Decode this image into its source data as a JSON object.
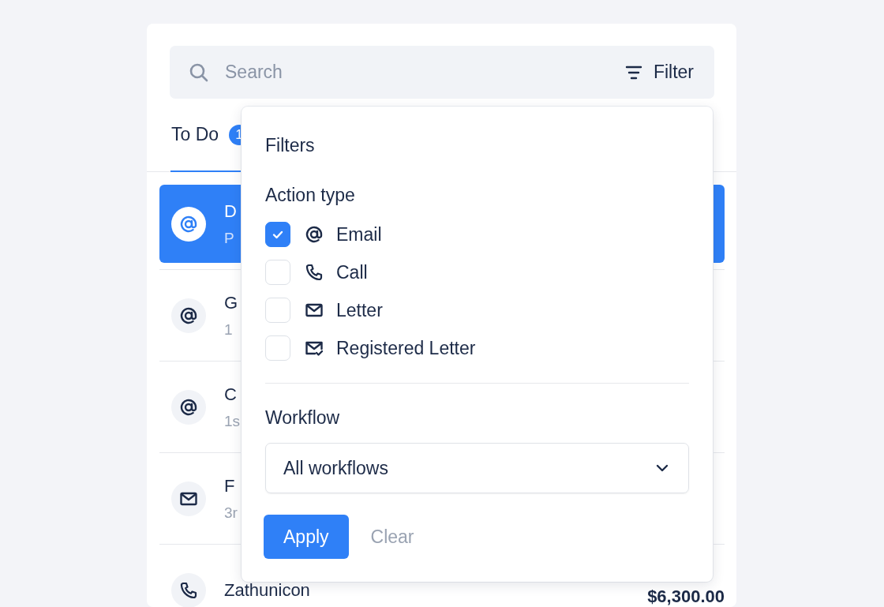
{
  "search": {
    "placeholder": "Search"
  },
  "filter_button": {
    "label": "Filter"
  },
  "tabs": [
    {
      "label": "To Do",
      "badge": "1",
      "selected": true
    }
  ],
  "tasks": [
    {
      "kind": "email",
      "title": "D",
      "subtitle": "P",
      "selected": true
    },
    {
      "kind": "email",
      "title": "G",
      "subtitle": "1",
      "selected": false
    },
    {
      "kind": "email",
      "title": "C",
      "subtitle": "1s",
      "selected": false
    },
    {
      "kind": "letter",
      "title": "F",
      "subtitle": "3r",
      "selected": false
    },
    {
      "kind": "call",
      "title": "Zathunicon",
      "amount": "$6,300.00",
      "selected": false
    }
  ],
  "filters": {
    "title": "Filters",
    "action_type": {
      "label": "Action type",
      "options": [
        {
          "kind": "email",
          "label": "Email",
          "checked": true
        },
        {
          "kind": "call",
          "label": "Call",
          "checked": false
        },
        {
          "kind": "letter",
          "label": "Letter",
          "checked": false
        },
        {
          "kind": "registered",
          "label": "Registered Letter",
          "checked": false
        }
      ]
    },
    "workflow": {
      "label": "Workflow",
      "value": "All workflows"
    },
    "buttons": {
      "apply": "Apply",
      "clear": "Clear"
    }
  }
}
